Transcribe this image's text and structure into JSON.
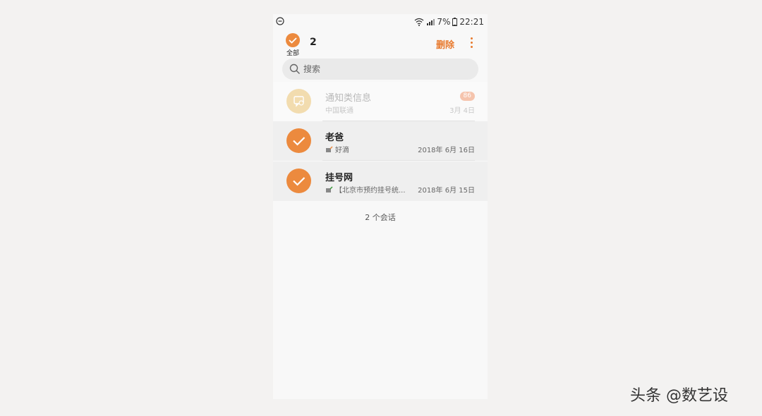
{
  "status_bar": {
    "battery": "7%",
    "time": "22:21"
  },
  "top_bar": {
    "select_all_label": "全部",
    "selected_count": "2",
    "delete_label": "删除"
  },
  "search": {
    "placeholder": "搜索"
  },
  "conversations": [
    {
      "name": "通知类信息",
      "snippet": "中国联通",
      "date": "3月 4日",
      "badge": "86",
      "selected": false,
      "disabled": true
    },
    {
      "name": "老爸",
      "snippet": "好滴",
      "date": "2018年 6月 16日",
      "selected": true
    },
    {
      "name": "挂号网",
      "snippet": "【北京市预约挂号统...",
      "date": "2018年 6月 15日",
      "selected": true
    }
  ],
  "footer": {
    "count_text": "2 个会话"
  },
  "watermark": "头条 @数艺设",
  "colors": {
    "accent": "#ec8a3e",
    "delete": "#e87a2e"
  }
}
